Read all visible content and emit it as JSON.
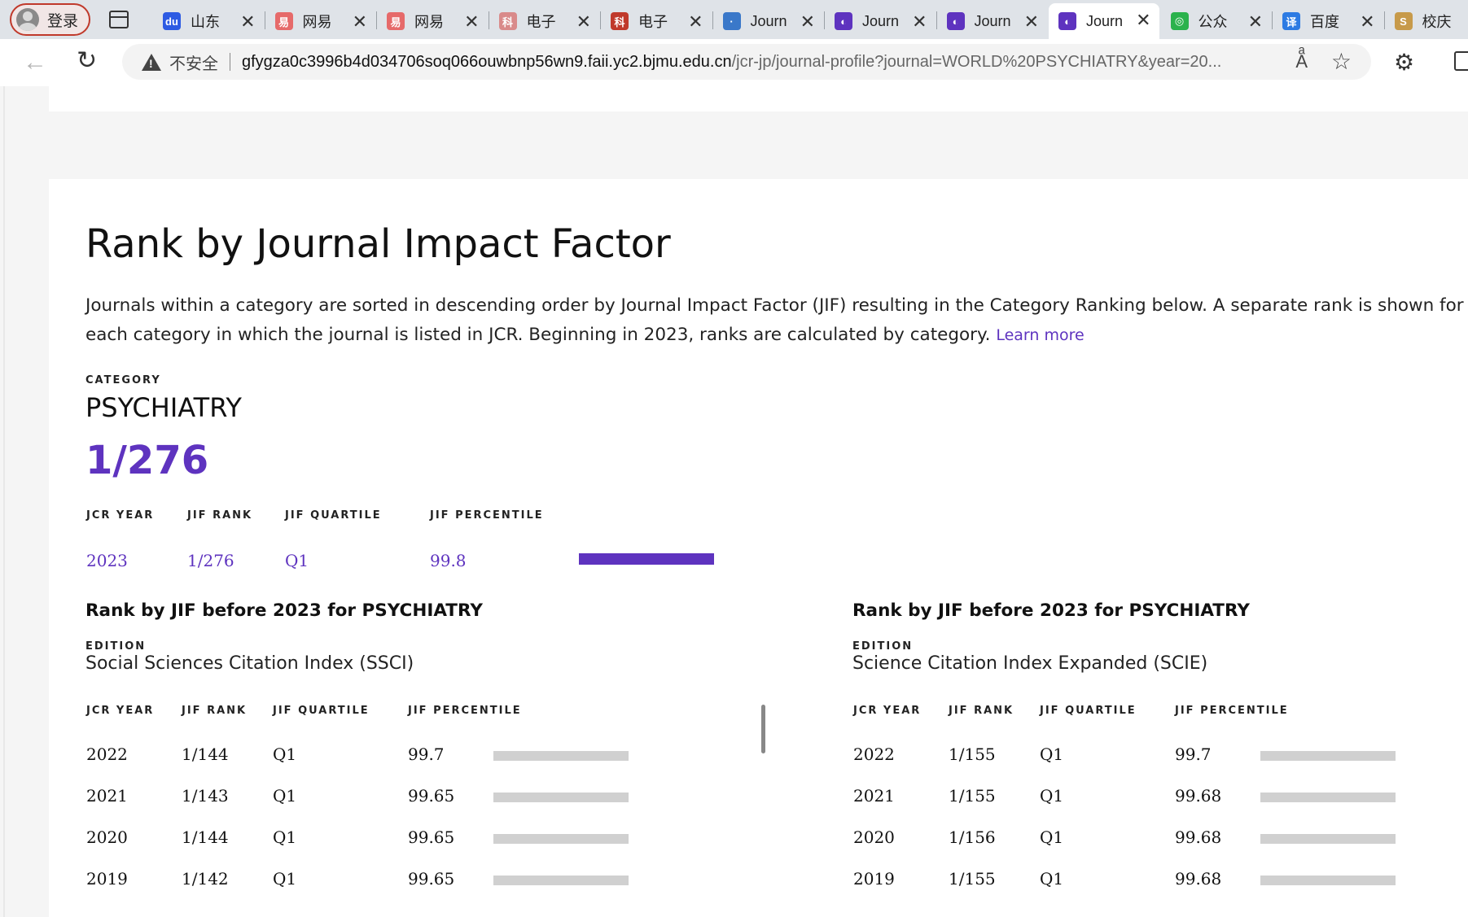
{
  "browser": {
    "profile_label": "登录",
    "tabs": [
      {
        "title": "山东",
        "fav_color": "#2d5be3",
        "fav_glyph": "du"
      },
      {
        "title": "网易",
        "fav_color": "#e66a6a",
        "fav_glyph": "易"
      },
      {
        "title": "网易",
        "fav_color": "#e66a6a",
        "fav_glyph": "易"
      },
      {
        "title": "电子",
        "fav_color": "#d98a8a",
        "fav_glyph": "科"
      },
      {
        "title": "电子",
        "fav_color": "#c0392b",
        "fav_glyph": "科"
      },
      {
        "title": "Journ",
        "fav_color": "#3a78c9",
        "fav_glyph": "·"
      },
      {
        "title": "Journ",
        "fav_color": "#5e33bf",
        "fav_glyph": "◐"
      },
      {
        "title": "Journ",
        "fav_color": "#5e33bf",
        "fav_glyph": "◐"
      },
      {
        "title": "Journ",
        "fav_color": "#5e33bf",
        "fav_glyph": "◐"
      },
      {
        "title": "公众",
        "fav_color": "#2bb24c",
        "fav_glyph": "◎"
      },
      {
        "title": "百度",
        "fav_color": "#2d7be3",
        "fav_glyph": "译"
      },
      {
        "title": "校庆",
        "fav_color": "#c79a4a",
        "fav_glyph": "S"
      }
    ],
    "active_tab_index": 8,
    "close_glyph": "✕",
    "insecure_label": "不安全",
    "url_host": "gfygza0c3996b4d034706soq066ouwbnp56wn9.faii.yc2.bjmu.edu.cn",
    "url_path": "/jcr-jp/journal-profile?journal=WORLD%20PSYCHIATRY&year=20..."
  },
  "section": {
    "title": "Rank by Journal Impact Factor",
    "intro": "Journals within a category are sorted in descending order by Journal Impact Factor (JIF) resulting in the Category Ranking below. A separate rank is shown for each category in which the journal is listed in JCR. Beginning in 2023, ranks are calculated by category.",
    "learn_more": "Learn more"
  },
  "category": {
    "caption": "CATEGORY",
    "name": "PSYCHIATRY",
    "rank": "1/276"
  },
  "current": {
    "headers": [
      "JCR YEAR",
      "JIF RANK",
      "JIF QUARTILE",
      "JIF PERCENTILE"
    ],
    "year": "2023",
    "rank": "1/276",
    "quartile": "Q1",
    "percentile": "99.8",
    "percentile_value": 99.8,
    "bar_color": "#5e33bf"
  },
  "history": [
    {
      "heading": "Rank by JIF before 2023 for PSYCHIATRY",
      "edition_caption": "EDITION",
      "edition": "Social Sciences Citation Index (SSCI)",
      "headers": [
        "JCR YEAR",
        "JIF RANK",
        "JIF QUARTILE",
        "JIF PERCENTILE"
      ],
      "rows": [
        {
          "year": "2022",
          "rank": "1/144",
          "quartile": "Q1",
          "percentile": "99.7",
          "pct": 99.7
        },
        {
          "year": "2021",
          "rank": "1/143",
          "quartile": "Q1",
          "percentile": "99.65",
          "pct": 99.65
        },
        {
          "year": "2020",
          "rank": "1/144",
          "quartile": "Q1",
          "percentile": "99.65",
          "pct": 99.65
        },
        {
          "year": "2019",
          "rank": "1/142",
          "quartile": "Q1",
          "percentile": "99.65",
          "pct": 99.65
        }
      ]
    },
    {
      "heading": "Rank by JIF before 2023 for PSYCHIATRY",
      "edition_caption": "EDITION",
      "edition": "Science Citation Index Expanded (SCIE)",
      "headers": [
        "JCR YEAR",
        "JIF RANK",
        "JIF QUARTILE",
        "JIF PERCENTILE"
      ],
      "rows": [
        {
          "year": "2022",
          "rank": "1/155",
          "quartile": "Q1",
          "percentile": "99.7",
          "pct": 99.7
        },
        {
          "year": "2021",
          "rank": "1/155",
          "quartile": "Q1",
          "percentile": "99.68",
          "pct": 99.68
        },
        {
          "year": "2020",
          "rank": "1/156",
          "quartile": "Q1",
          "percentile": "99.68",
          "pct": 99.68
        },
        {
          "year": "2019",
          "rank": "1/155",
          "quartile": "Q1",
          "percentile": "99.68",
          "pct": 99.68
        }
      ]
    }
  ],
  "colors": {
    "accent": "#5e33bf",
    "history_bar": "#d0d0d0"
  }
}
